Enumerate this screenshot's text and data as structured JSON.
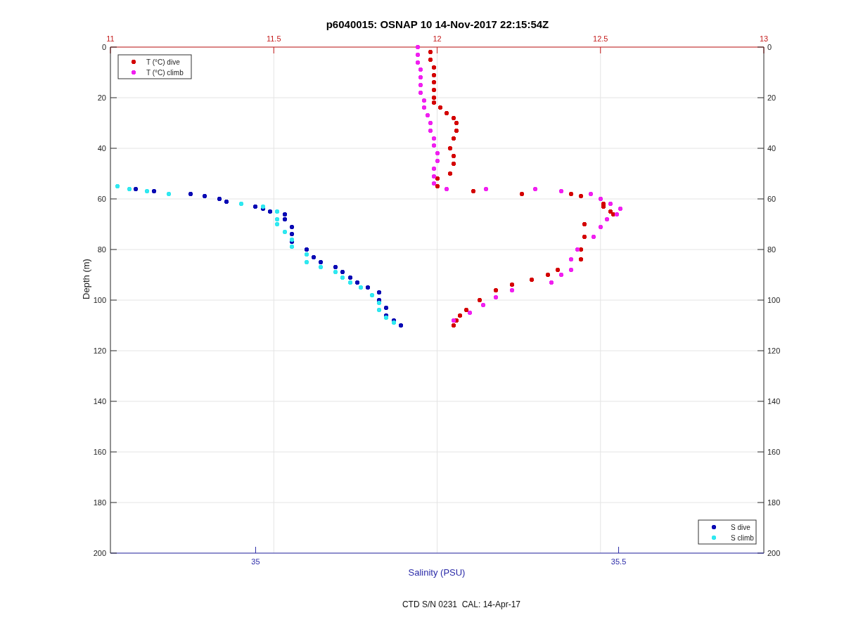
{
  "figure": {
    "title": "p6040015: OSNAP 10 14-Nov-2017 22:15:54Z",
    "temperature": {
      "chart_data": {
        "type": "scatter",
        "grid": true,
        "legend": true,
        "xlim": [
          11,
          13
        ],
        "ylim": [
          200,
          0
        ],
        "xticks": [
          11,
          11.5,
          12,
          12.5,
          13
        ],
        "yticks": [
          0,
          20,
          40,
          60,
          80,
          100,
          120,
          140,
          160,
          180,
          200
        ],
        "series": [
          {
            "name": "T (°C) dive",
            "color": "#d40000",
            "x": [
              11.98,
              11.98,
              11.99,
              11.99,
              11.99,
              11.99,
              11.99,
              11.99,
              12.01,
              12.03,
              12.05,
              12.06,
              12.06,
              12.05,
              12.04,
              12.05,
              12.05,
              12.04,
              12.0,
              12.0,
              12.11,
              12.26,
              12.41,
              12.44,
              12.51,
              12.51,
              12.53,
              12.54,
              12.45,
              12.45,
              12.44,
              12.44,
              12.37,
              12.34,
              12.29,
              12.23,
              12.18,
              12.13,
              12.09,
              12.07,
              12.06,
              12.05
            ],
            "values": [
              2,
              5,
              8,
              11,
              14,
              17,
              20,
              22,
              24,
              26,
              28,
              30,
              33,
              36,
              40,
              43,
              46,
              50,
              52,
              55,
              57,
              58,
              58,
              59,
              62,
              63,
              65,
              66,
              70,
              75,
              80,
              84,
              88,
              90,
              92,
              94,
              96,
              100,
              104,
              106,
              108,
              110
            ]
          },
          {
            "name": "T (°C) climb",
            "color": "#f020f0",
            "x": [
              11.94,
              11.94,
              11.94,
              11.95,
              11.95,
              11.95,
              11.95,
              11.96,
              11.96,
              11.97,
              11.98,
              11.98,
              11.99,
              11.99,
              12.0,
              12.0,
              11.99,
              11.99,
              11.99,
              12.03,
              12.15,
              12.3,
              12.38,
              12.47,
              12.5,
              12.53,
              12.56,
              12.55,
              12.52,
              12.5,
              12.48,
              12.43,
              12.41,
              12.41,
              12.38,
              12.35,
              12.23,
              12.18,
              12.14,
              12.1,
              12.05
            ],
            "values": [
              0,
              3,
              6,
              9,
              12,
              15,
              18,
              21,
              24,
              27,
              30,
              33,
              36,
              39,
              42,
              45,
              48,
              51,
              54,
              56,
              56,
              56,
              57,
              58,
              60,
              62,
              64,
              66,
              68,
              71,
              75,
              80,
              84,
              88,
              90,
              93,
              96,
              99,
              102,
              105,
              108
            ]
          }
        ]
      }
    },
    "salinity": {
      "chart_data": {
        "type": "scatter",
        "legend": true,
        "xlabel": "Salinity (PSU)",
        "ylabel": "Depth (m)",
        "xlim": [
          34.8,
          35.7
        ],
        "ylim": [
          200,
          0
        ],
        "xticks": [
          35,
          35.5
        ],
        "yticks": [
          0,
          20,
          40,
          60,
          80,
          100,
          120,
          140,
          160,
          180,
          200
        ],
        "series": [
          {
            "name": "S dive",
            "color": "#0a0ab4",
            "x": [
              34.835,
              34.86,
              34.91,
              34.93,
              34.95,
              34.96,
              35.0,
              35.01,
              35.02,
              35.04,
              35.04,
              35.05,
              35.05,
              35.05,
              35.07,
              35.08,
              35.09,
              35.11,
              35.12,
              35.13,
              35.14,
              35.155,
              35.17,
              35.17,
              35.18,
              35.18,
              35.19,
              35.2
            ],
            "values": [
              56,
              57,
              58,
              59,
              60,
              61,
              63,
              64,
              65,
              66,
              68,
              71,
              74,
              77,
              80,
              83,
              85,
              87,
              89,
              91,
              93,
              95,
              97,
              100,
              103,
              106,
              108,
              110
            ]
          },
          {
            "name": "S climb",
            "color": "#30e8f0",
            "x": [
              34.81,
              34.826,
              34.85,
              34.88,
              34.98,
              35.01,
              35.03,
              35.03,
              35.03,
              35.04,
              35.05,
              35.05,
              35.07,
              35.07,
              35.09,
              35.11,
              35.12,
              35.13,
              35.145,
              35.16,
              35.17,
              35.17,
              35.18,
              35.19
            ],
            "values": [
              55,
              56,
              57,
              58,
              62,
              63,
              65,
              68,
              70,
              73,
              76,
              79,
              82,
              85,
              87,
              89,
              91,
              93,
              95,
              98,
              101,
              104,
              107,
              109
            ]
          }
        ]
      }
    },
    "footer": "CTD S/N 0231  CAL: 14-Apr-17"
  }
}
